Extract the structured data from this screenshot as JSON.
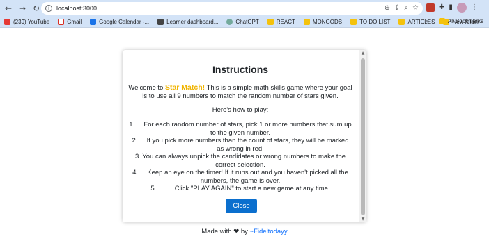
{
  "browser": {
    "url": "localhost:3000",
    "bookmarks": [
      {
        "label": "(239) YouTube",
        "icon": "youtube-icon"
      },
      {
        "label": "Gmail",
        "icon": "gmail-icon"
      },
      {
        "label": "Google Calendar -...",
        "icon": "calendar-icon"
      },
      {
        "label": "Learner dashboard...",
        "icon": "learner-icon"
      },
      {
        "label": "ChatGPT",
        "icon": "chatgpt-icon"
      },
      {
        "label": "REACT",
        "icon": "folder-icon"
      },
      {
        "label": "MONGODB",
        "icon": "folder-icon"
      },
      {
        "label": "TO DO LIST",
        "icon": "folder-icon"
      },
      {
        "label": "ARTICLES",
        "icon": "folder-icon"
      },
      {
        "label": "New folder",
        "icon": "folder-icon"
      }
    ],
    "all_bookmarks": "All Bookmarks"
  },
  "modal": {
    "title": "Instructions",
    "intro_prefix": "Welcome to ",
    "brand": "Star Match!",
    "intro_suffix": " This is a simple math skills game where your goal is to use all 9 numbers to match the random number of stars given.",
    "howto": "Here's how to play:",
    "steps": [
      "1.     For each random number of stars, pick 1 or more numbers that sum up to the given number.",
      "2.     If you pick more numbers than the count of stars, they will be marked as wrong in red.",
      "3. You can always unpick the candidates or wrong numbers to make the correct selection.",
      "4.     Keep an eye on the timer! If it runs out and you haven't picked all the numbers, the game is over.",
      "5.          Click \"PLAY AGAIN\" to start a new game at any time."
    ],
    "close_label": "Close"
  },
  "footer": {
    "prefix": "Made with",
    "heart": "❤",
    "by": "by",
    "author": "~Fideltodayy"
  },
  "colors": {
    "brand": "#f0b400",
    "button": "#0b6fce",
    "link": "#0d6efd",
    "chrome": "#d3e3f7"
  }
}
